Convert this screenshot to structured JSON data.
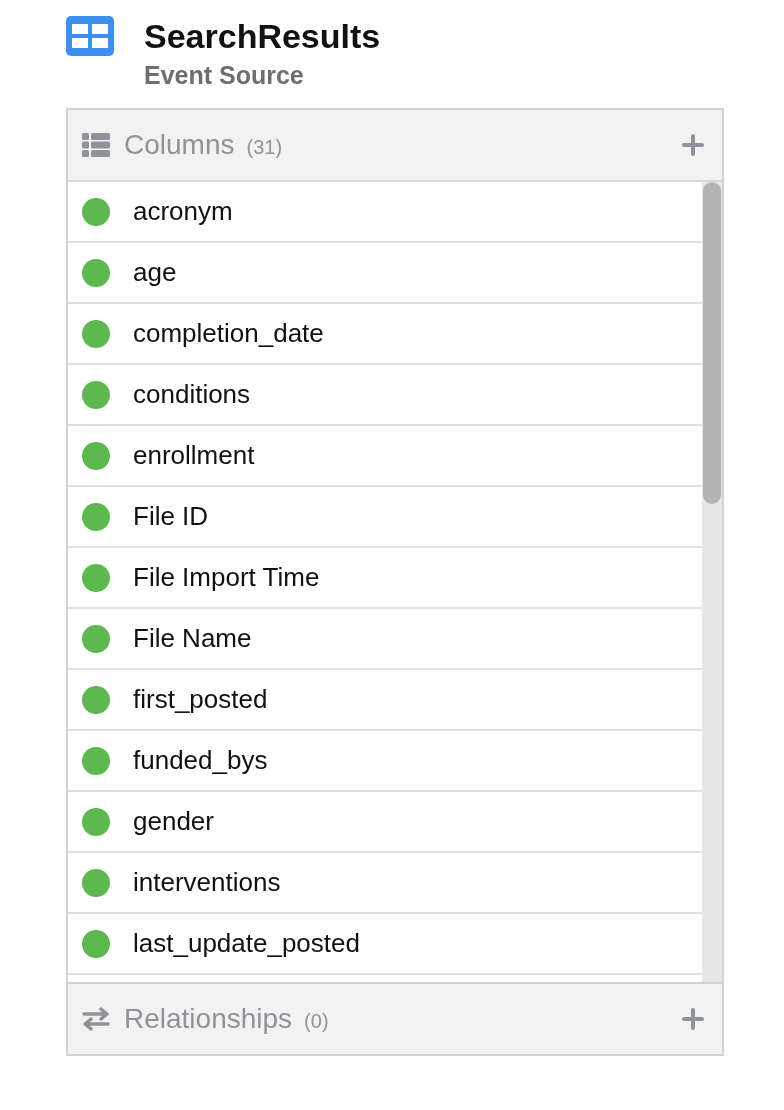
{
  "header": {
    "title": "SearchResults",
    "subtitle": "Event Source"
  },
  "columns_section": {
    "label": "Columns",
    "count": "(31)",
    "items": [
      {
        "name": "acronym"
      },
      {
        "name": "age"
      },
      {
        "name": "completion_date"
      },
      {
        "name": "conditions"
      },
      {
        "name": "enrollment"
      },
      {
        "name": "File ID"
      },
      {
        "name": "File Import Time"
      },
      {
        "name": "File Name"
      },
      {
        "name": "first_posted"
      },
      {
        "name": "funded_bys"
      },
      {
        "name": "gender"
      },
      {
        "name": "interventions"
      },
      {
        "name": "last_update_posted"
      }
    ]
  },
  "relationships_section": {
    "label": "Relationships",
    "count": "(0)"
  }
}
